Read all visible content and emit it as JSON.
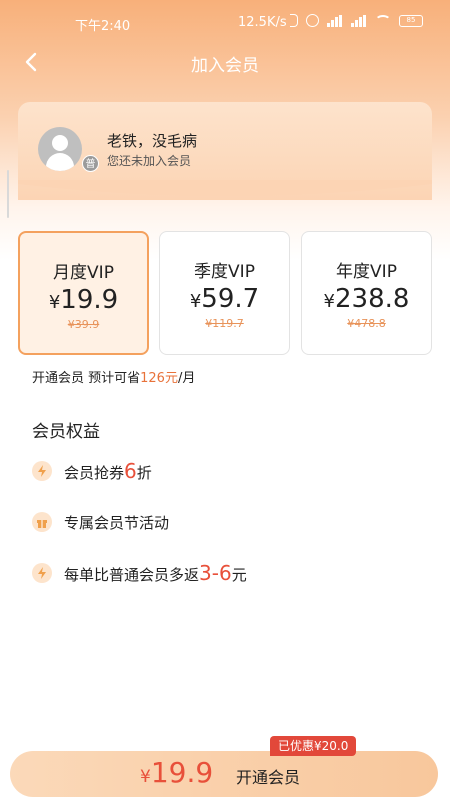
{
  "status": {
    "time": "下午2:40",
    "speed": "12.5K/s",
    "battery": "85"
  },
  "nav": {
    "title": "加入会员"
  },
  "user": {
    "name": "老铁，没毛病",
    "subtitle": "您还未加入会员",
    "badge": "普"
  },
  "plans": [
    {
      "name": "月度VIP",
      "yen": "¥",
      "price": "19.9",
      "original": "¥39.9",
      "selected": true
    },
    {
      "name": "季度VIP",
      "yen": "¥",
      "price": "59.7",
      "original": "¥119.7",
      "selected": false
    },
    {
      "name": "年度VIP",
      "yen": "¥",
      "price": "238.8",
      "original": "¥478.8",
      "selected": false
    }
  ],
  "saving": {
    "prefix": "开通会员 预计可省",
    "amount": "126元",
    "suffix": "/月"
  },
  "benefits": {
    "title": "会员权益",
    "items": [
      {
        "icon": "lightning-icon",
        "text_before": "会员抢券",
        "highlight": "6",
        "text_after": "折"
      },
      {
        "icon": "gift-icon",
        "text_before": "专属会员节活动",
        "highlight": "",
        "text_after": ""
      },
      {
        "icon": "lightning-icon",
        "text_before": "每单比普通会员多返",
        "highlight": "3-6",
        "text_after": "元"
      }
    ]
  },
  "bottom": {
    "yen": "¥",
    "price": "19.9",
    "label": "开通会员",
    "discount_tag": "已优惠¥20.0"
  },
  "colors": {
    "accent": "#f4a15e",
    "highlight": "#e8503a",
    "header_top": "#f8b07a"
  }
}
